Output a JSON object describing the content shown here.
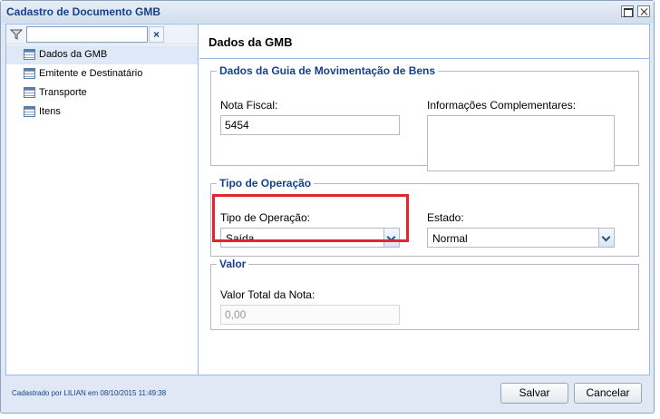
{
  "window": {
    "title": "Cadastro de Documento GMB"
  },
  "sidebar": {
    "filter_value": "",
    "clear_label": "×",
    "items": [
      {
        "label": "Dados da GMB",
        "icon": "document-list-icon",
        "selected": true
      },
      {
        "label": "Emitente e Destinatário",
        "icon": "document-list-icon",
        "selected": false
      },
      {
        "label": "Transporte",
        "icon": "document-list-icon",
        "selected": false
      },
      {
        "label": "Itens",
        "icon": "document-list-icon",
        "selected": false
      }
    ]
  },
  "main": {
    "header_title": "Dados da GMB",
    "section_guia": {
      "legend": "Dados da Guia de Movimentação de Bens",
      "nota_fiscal_label": "Nota Fiscal:",
      "nota_fiscal_value": "5454",
      "info_label": "Informações Complementares:",
      "info_value": ""
    },
    "section_operacao": {
      "legend": "Tipo de Operação",
      "tipo_label": "Tipo de Operação:",
      "tipo_value": "Saída",
      "estado_label": "Estado:",
      "estado_value": "Normal"
    },
    "section_valor": {
      "legend": "Valor",
      "valor_label": "Valor Total da Nota:",
      "valor_placeholder": "0,00"
    }
  },
  "footer": {
    "status": "Cadastrado por LILIAN em 08/10/2015 11:49:38",
    "save_label": "Salvar",
    "cancel_label": "Cancelar"
  },
  "colors": {
    "accent": "#15428b",
    "highlight": "#e3262e",
    "border": "#99bbe8"
  }
}
